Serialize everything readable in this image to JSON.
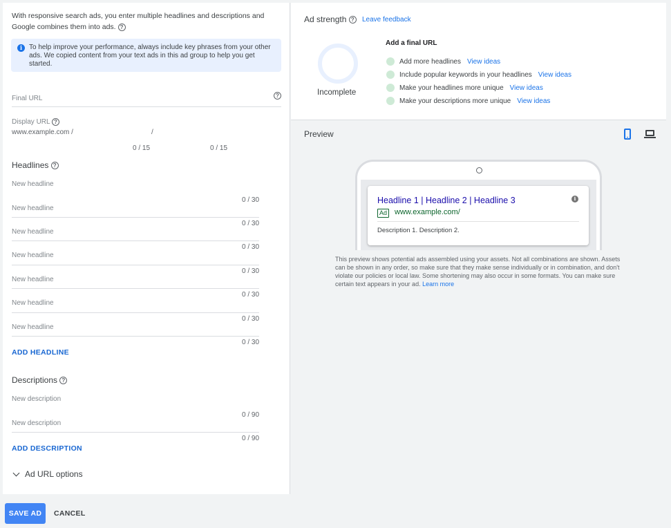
{
  "intro": {
    "text": "With responsive search ads, you enter multiple headlines and descriptions and Google combines them into ads."
  },
  "info_box": {
    "text": "To help improve your performance, always include key phrases from your other ads. We copied content from your text ads in this ad group to help you get started."
  },
  "final_url": {
    "placeholder": "Final URL"
  },
  "display_url": {
    "label": "Display URL",
    "base": "www.example.com /",
    "separator": "/",
    "path1_counter": "0 / 15",
    "path2_counter": "0 / 15"
  },
  "headlines": {
    "title": "Headlines",
    "placeholder": "New headline",
    "counter": "0 / 30",
    "items": [
      "New headline",
      "New headline",
      "New headline",
      "New headline",
      "New headline",
      "New headline"
    ],
    "add_label": "ADD HEADLINE"
  },
  "descriptions": {
    "title": "Descriptions",
    "counter": "0 / 90",
    "items": [
      "New description",
      "New description"
    ],
    "add_label": "ADD DESCRIPTION"
  },
  "url_options": {
    "label": "Ad URL options"
  },
  "ad_strength": {
    "title": "Ad strength",
    "feedback_label": "Leave feedback",
    "status": "Incomplete",
    "tips_title": "Add a final URL",
    "tips": [
      {
        "text": "Add more headlines",
        "link": "View ideas"
      },
      {
        "text": "Include popular keywords in your headlines",
        "link": "View ideas"
      },
      {
        "text": "Make your headlines more unique",
        "link": "View ideas"
      },
      {
        "text": "Make your descriptions more unique",
        "link": "View ideas"
      }
    ],
    "colors": {
      "ring": "#e8f0fe",
      "dot": "#ceead6",
      "link": "#1a73e8"
    }
  },
  "preview": {
    "title": "Preview",
    "ad": {
      "headline": "Headline 1 | Headline 2 | Headline 3",
      "badge": "Ad",
      "url": "www.example.com/",
      "description": "Description 1. Description 2."
    },
    "note": "This preview shows potential ads assembled using your assets. Not all combinations are shown. Assets can be shown in any order, so make sure that they make sense individually or in combination, and don't violate our policies or local law. Some shortening may also occur in some formats. You can make sure certain text appears in your ad.",
    "note_link": "Learn more",
    "icons": [
      "smartphone-icon",
      "laptop-icon"
    ]
  },
  "actions": {
    "save_label": "SAVE AD",
    "cancel_label": "CANCEL"
  },
  "colors": {
    "primary": "#4285f4",
    "link": "#1967d2",
    "ad_headline": "#1a0dab",
    "ad_url": "#0d652d"
  }
}
